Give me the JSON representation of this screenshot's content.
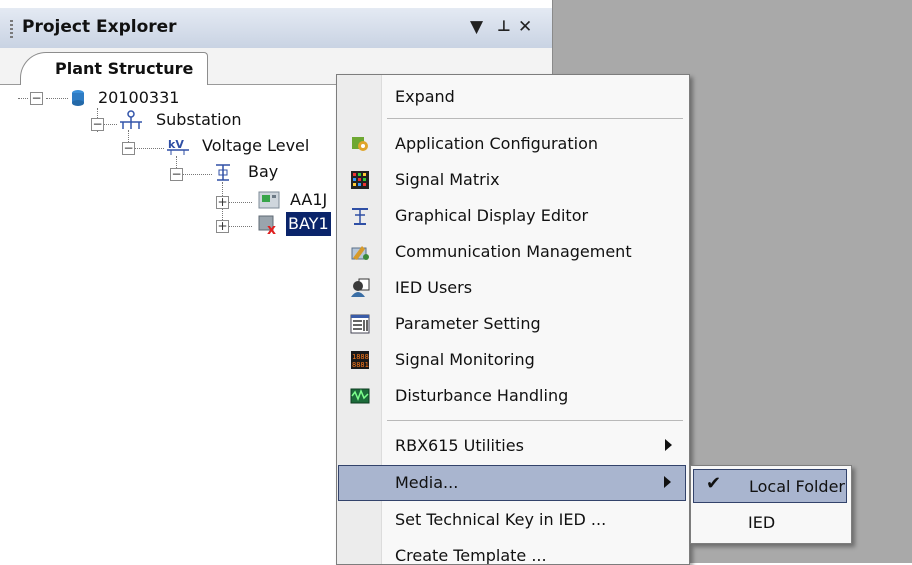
{
  "panel": {
    "title": "Project Explorer",
    "pin_glyph": "▼ ⊥ ✕",
    "tab_label": "Plant Structure"
  },
  "tree": {
    "root": "20100331",
    "substation": "Substation",
    "voltage_level": "Voltage Level",
    "bay": "Bay",
    "ied1": "AA1J",
    "ied2": "BAY1"
  },
  "context_menu": {
    "items": [
      {
        "label": "Expand",
        "icon": "none"
      },
      {
        "label": "Application Configuration",
        "icon": "application-configuration-icon"
      },
      {
        "label": "Signal Matrix",
        "icon": "signal-matrix-icon"
      },
      {
        "label": "Graphical Display Editor",
        "icon": "graphical-display-editor-icon"
      },
      {
        "label": "Communication Management",
        "icon": "communication-management-icon"
      },
      {
        "label": "IED Users",
        "icon": "ied-users-icon"
      },
      {
        "label": "Parameter Setting",
        "icon": "parameter-setting-icon"
      },
      {
        "label": "Signal Monitoring",
        "icon": "signal-monitoring-icon"
      },
      {
        "label": "Disturbance Handling",
        "icon": "disturbance-handling-icon"
      },
      {
        "label": "RBX615 Utilities",
        "icon": "none"
      },
      {
        "label": "Media...",
        "icon": "none"
      },
      {
        "label": "Set Technical Key in IED ...",
        "icon": "none"
      },
      {
        "label": "Create Template ...",
        "icon": "none"
      }
    ]
  },
  "submenu": {
    "items": [
      {
        "label": "Local Folder",
        "checked": true
      },
      {
        "label": "IED",
        "checked": false
      }
    ]
  },
  "colors": {
    "highlight": "#a9b5cf",
    "selection": "#0a246a",
    "workspace": "#a9a9a9"
  }
}
